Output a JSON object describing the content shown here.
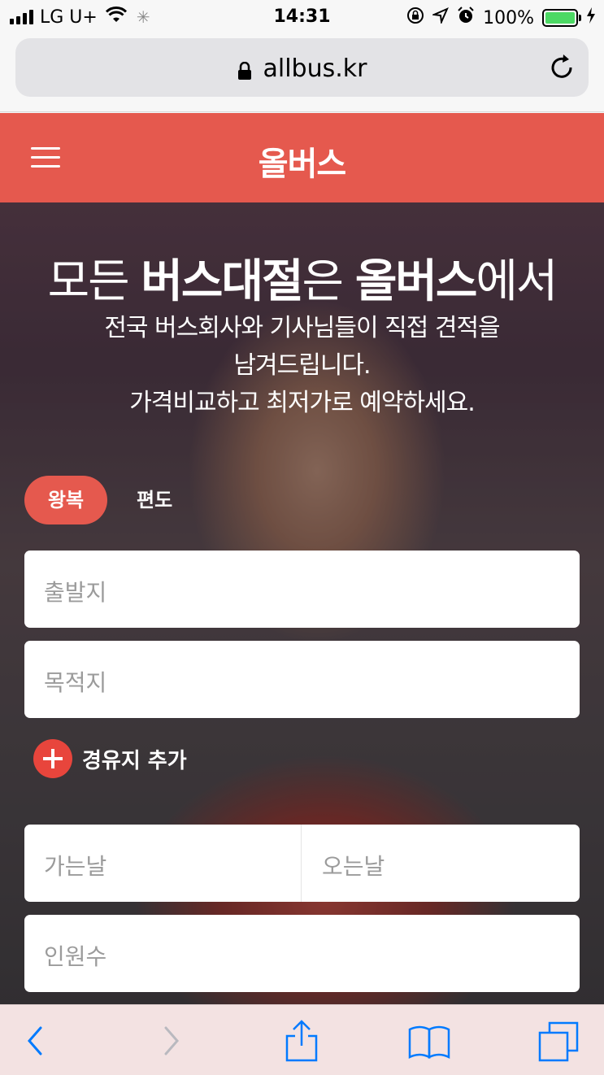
{
  "status": {
    "carrier": "LG U+",
    "time": "14:31",
    "battery": "100%",
    "battery_color": "#4cd964",
    "icons": [
      "signal-icon",
      "wifi-icon",
      "loading-spinner-icon",
      "orientation-lock-icon",
      "location-arrow-icon",
      "alarm-icon",
      "battery-icon",
      "charging-icon"
    ]
  },
  "browser": {
    "url": "allbus.kr",
    "icons": [
      "lock-icon",
      "reload-icon"
    ]
  },
  "header": {
    "logo": "올버스",
    "accent": "#e5594e"
  },
  "hero": {
    "title_prefix": "모든 ",
    "title_bold1": "버스대절",
    "title_mid": "은 ",
    "title_bold2": "올버스",
    "title_suffix": "에서",
    "desc_line1": "전국 버스회사와 기사님들이 직접 견적을",
    "desc_line2": "남겨드립니다.",
    "desc_line3": "가격비교하고 최저가로 예약하세요."
  },
  "trip_type": {
    "round_trip": "왕복",
    "one_way": "편도",
    "selected": "왕복"
  },
  "form": {
    "departure_placeholder": "출발지",
    "destination_placeholder": "목적지",
    "add_waypoint": "경유지 추가",
    "go_date_placeholder": "가는날",
    "return_date_placeholder": "오는날",
    "passengers_placeholder": "인원수"
  },
  "toolbar": {
    "icons": [
      "back-icon",
      "forward-icon",
      "share-icon",
      "bookmarks-icon",
      "tabs-icon"
    ],
    "tint": "#007aff"
  }
}
